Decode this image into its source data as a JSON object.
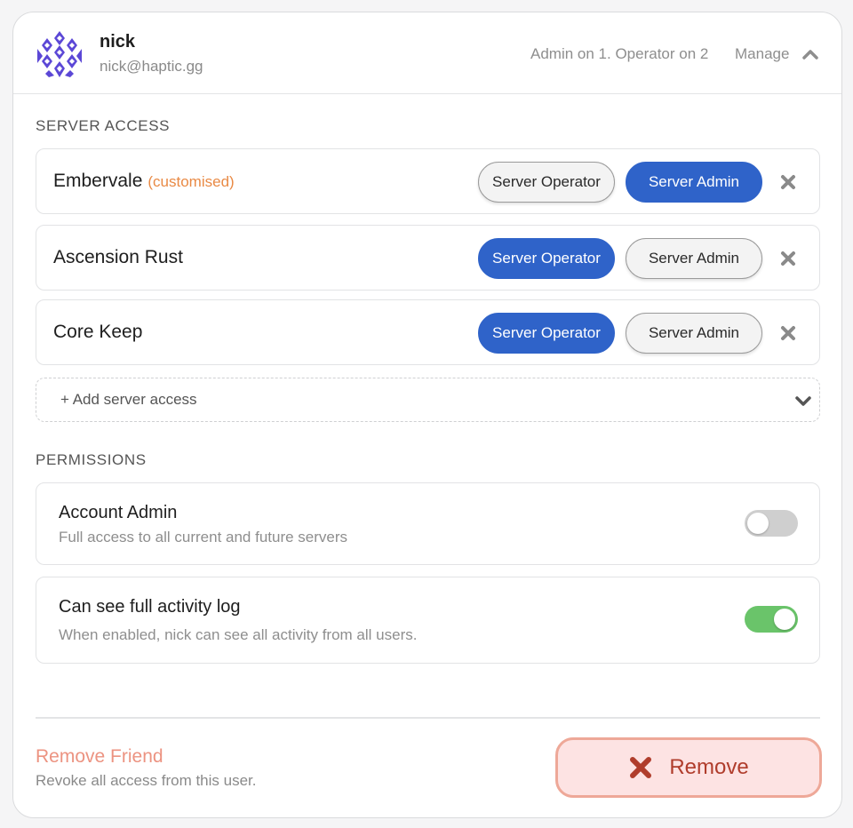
{
  "user": {
    "name": "nick",
    "email": "nick@haptic.gg",
    "access_summary": "Admin on 1. Operator on 2",
    "manage_label": "Manage"
  },
  "server_access": {
    "heading": "SERVER ACCESS",
    "roles": {
      "operator": "Server Operator",
      "admin": "Server Admin"
    },
    "servers": [
      {
        "name": "Embervale",
        "tag": "(customised)",
        "active_role": "admin"
      },
      {
        "name": "Ascension Rust",
        "tag": "",
        "active_role": "operator"
      },
      {
        "name": "Core Keep",
        "tag": "",
        "active_role": "operator"
      }
    ],
    "add_label": "+ Add server access"
  },
  "permissions": {
    "heading": "PERMISSIONS",
    "items": [
      {
        "title": "Account Admin",
        "description": "Full access to all current and future servers",
        "enabled": false
      },
      {
        "title": "Can see full activity log",
        "description": "When enabled, nick can see all activity from all users.",
        "enabled": true
      }
    ]
  },
  "danger": {
    "title": "Remove Friend",
    "description": "Revoke all access from this user.",
    "button_label": "Remove"
  },
  "colors": {
    "accent": "#2f63c9",
    "toggle_on": "#6ac46a",
    "toggle_off": "#cfcfcf",
    "customised_tag": "#e98a45",
    "danger_text": "#ec9381",
    "danger_bg": "#fde3e3",
    "danger_icon": "#b03d2c",
    "avatar": "#5b47d6"
  }
}
